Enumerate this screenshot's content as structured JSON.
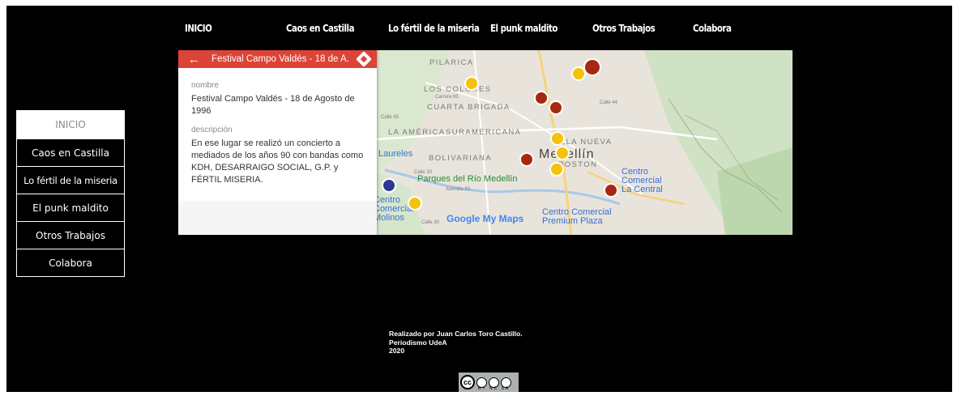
{
  "top_nav": [
    "INICIO",
    "Caos en Castilla",
    "Lo fértil de la miseria",
    "El punk maldito",
    "Otros Trabajos",
    "Colabora"
  ],
  "side_nav": [
    "INICIO",
    "Caos en Castilla",
    "Lo fértil de la miseria",
    "El punk maldito",
    "Otros Trabajos",
    "Colabora"
  ],
  "map_panel": {
    "header_title": "Festival Campo Valdés - 18 de A...",
    "fields": [
      {
        "label": "nombre",
        "value": "Festival Campo Valdés - 18 de Agosto de 1996"
      },
      {
        "label": "descripción",
        "value": "En ese lugar se realizó un concierto a mediados de los años 90 con bandas como KDH, DESARRAIGO SOCIAL, G.P. y FÉRTIL MISERIA."
      }
    ]
  },
  "map": {
    "labels": [
      "PILARICA",
      "LOS COLORES",
      "CUARTA BRIGADA",
      "LA AMÉRICA",
      "SURAMERICANA",
      "VILLA NUEVA",
      "BOLIVARIANA",
      "BOSTON"
    ],
    "city": "Medellín",
    "pois": [
      "Laureles",
      "Parques del Río Medellín",
      "Centro Comercial La Central",
      "Centro Comercial Premium Plaza",
      "Centro Comercial Molinos"
    ],
    "streets": [
      "Calle 45",
      "Calle 44",
      "Carrera 65",
      "Calle 33",
      "Avenida 33",
      "Calle 30"
    ],
    "attribution": "Google My Maps",
    "pin_colors": {
      "red": "#a52714",
      "yellow": "#f4c20d"
    }
  },
  "footer": {
    "line1": "Realizado por Juan Carlos Toro Castillo.",
    "line2": "Periodismo UdeA",
    "line3": "2020",
    "license_icon": "cc-by-nc-sa-badge",
    "license_text": "BY NC SA"
  },
  "colors": {
    "background": "#000000",
    "panel_header": "#db4437"
  }
}
